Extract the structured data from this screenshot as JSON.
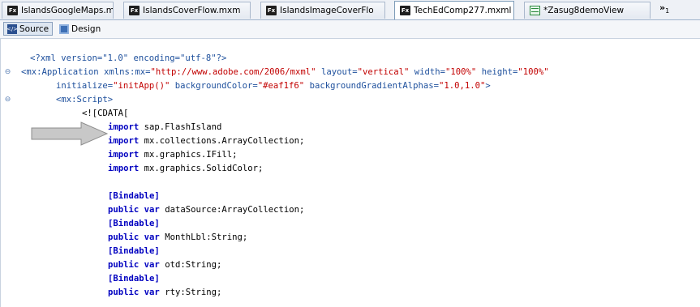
{
  "tabs": [
    {
      "label": "IslandsGoogleMaps.mx",
      "icon": "fx-file-icon",
      "active": false,
      "close": ""
    },
    {
      "label": "IslandsCoverFlow.mxm",
      "icon": "fx-file-icon",
      "active": false,
      "close": ""
    },
    {
      "label": "IslandsImageCoverFlo",
      "icon": "fx-file-icon",
      "active": false,
      "close": ""
    },
    {
      "label": "TechEdComp277.mxml",
      "icon": "fx-file-icon",
      "active": true,
      "close": "✕"
    },
    {
      "label": "*Zasug8demoView",
      "icon": "design-file-icon",
      "active": false,
      "close": ""
    }
  ],
  "tab_overflow": {
    "symbol": "»",
    "count": "1"
  },
  "modes": {
    "source_label": "Source",
    "design_label": "Design",
    "active": "Source"
  },
  "code": {
    "line1": "<?xml version=\"1.0\" encoding=\"utf-8\"?>",
    "line2_tag": "<mx:Application",
    "line2_attr1": " xmlns:mx=",
    "line2_val1": "\"http://www.adobe.com/2006/mxml\"",
    "line2_attr2": " layout=",
    "line2_val2": "\"vertical\"",
    "line2_attr3": " width=",
    "line2_val3": "\"100%\"",
    "line2_attr4": " height=",
    "line2_val4": "\"100%\"",
    "line3_attr1": "initialize=",
    "line3_val1": "\"initApp()\"",
    "line3_attr2": " backgroundColor=",
    "line3_val2": "\"#eaf1f6\"",
    "line3_attr3": " backgroundGradientAlphas=",
    "line3_val3": "\"1.0,1.0\"",
    "line3_end": ">",
    "line4": "<mx:Script>",
    "line5": "<![CDATA[",
    "import_kw": "import",
    "imports": [
      "sap.FlashIsland",
      "mx.collections.ArrayCollection;",
      "mx.graphics.IFill;",
      "mx.graphics.SolidColor;"
    ],
    "bindable": "[Bindable]",
    "public_kw": "public",
    "var_kw": "var",
    "vars": [
      "dataSource:ArrayCollection;",
      "MonthLbl:String;",
      "otd:String;",
      "rty:String;"
    ]
  },
  "colors": {
    "keyword": "#0000c0",
    "tag": "#1d4f9c",
    "string": "#c20000",
    "arrow": "#c8c8c8"
  }
}
